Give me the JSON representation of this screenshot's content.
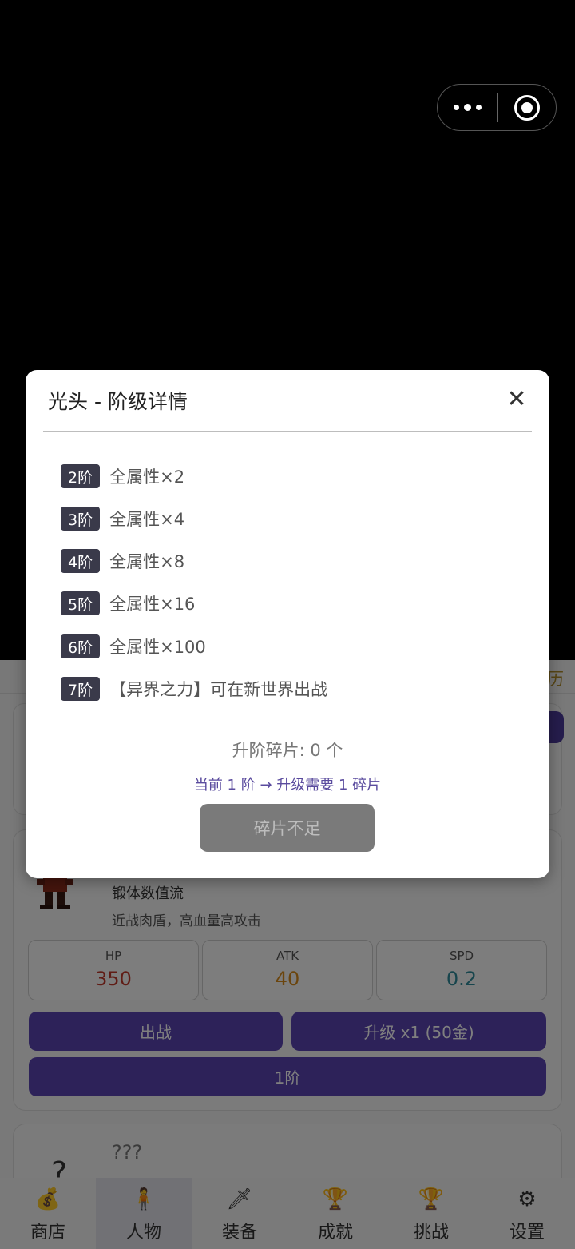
{
  "background": {
    "tabs_edge_text": "历",
    "hero": {
      "title": "锻体数值流",
      "desc": "近战肉盾，高血量高攻击",
      "stats": [
        {
          "key": "HP",
          "value": "350",
          "color": "#c0392b"
        },
        {
          "key": "ATK",
          "value": "40",
          "color": "#d68a1a"
        },
        {
          "key": "SPD",
          "value": "0.2",
          "color": "#2e8b9a"
        }
      ],
      "deploy_label": "出战",
      "upgrade_label": "升级 x1 (50金)",
      "tier_label": "1阶"
    },
    "unknown": {
      "symbol": "?",
      "name": "???"
    }
  },
  "bottom_nav": [
    {
      "label": "商店",
      "icon": "money-bag-icon",
      "glyph": "💰",
      "active": false
    },
    {
      "label": "人物",
      "icon": "person-icon",
      "glyph": "🧍",
      "active": true
    },
    {
      "label": "装备",
      "icon": "sword-icon",
      "glyph": "🗡",
      "active": false
    },
    {
      "label": "成就",
      "icon": "trophy-icon",
      "glyph": "🏆",
      "active": false
    },
    {
      "label": "挑战",
      "icon": "trophy-icon",
      "glyph": "🏆",
      "active": false
    },
    {
      "label": "设置",
      "icon": "gear-icon",
      "glyph": "⚙",
      "active": false
    }
  ],
  "modal": {
    "title": "光头 - 阶级详情",
    "close_symbol": "✕",
    "tiers": [
      {
        "badge": "2阶",
        "text": "全属性×2"
      },
      {
        "badge": "3阶",
        "text": "全属性×4"
      },
      {
        "badge": "4阶",
        "text": "全属性×8"
      },
      {
        "badge": "5阶",
        "text": "全属性×16"
      },
      {
        "badge": "6阶",
        "text": "全属性×100"
      },
      {
        "badge": "7阶",
        "text": "【异界之力】可在新世界出战"
      }
    ],
    "fragments": "升阶碎片: 0 个",
    "upgrade_hint": "当前 1 阶 → 升级需要 1 碎片",
    "button_label": "碎片不足"
  }
}
